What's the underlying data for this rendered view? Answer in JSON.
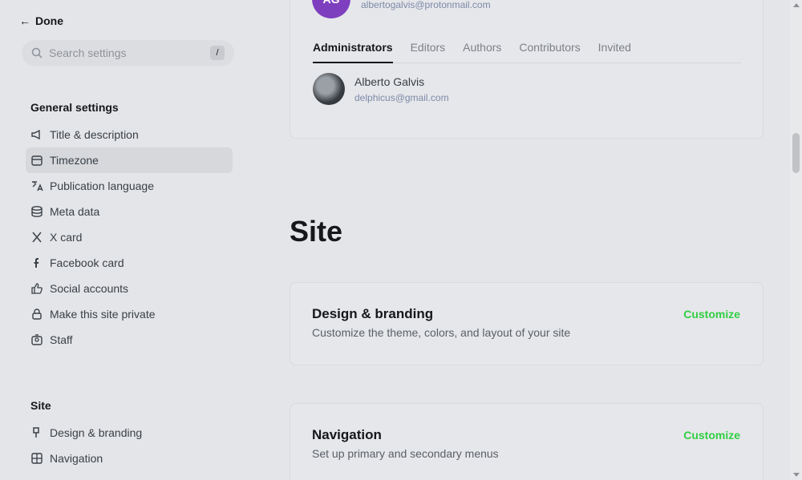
{
  "sidebar": {
    "done_label": "Done",
    "search_placeholder": "Search settings",
    "search_shortcut": "/",
    "general_title": "General settings",
    "general_items": [
      {
        "label": "Title & description",
        "icon": "megaphone-icon"
      },
      {
        "label": "Timezone",
        "icon": "calendar-icon"
      },
      {
        "label": "Publication language",
        "icon": "translate-icon"
      },
      {
        "label": "Meta data",
        "icon": "database-icon"
      },
      {
        "label": "X card",
        "icon": "x-logo-icon"
      },
      {
        "label": "Facebook card",
        "icon": "facebook-icon"
      },
      {
        "label": "Social accounts",
        "icon": "thumbs-up-icon"
      },
      {
        "label": "Make this site private",
        "icon": "lock-icon"
      },
      {
        "label": "Staff",
        "icon": "staff-icon"
      }
    ],
    "active_index": 1,
    "site_title": "Site",
    "site_items": [
      {
        "label": "Design & branding",
        "icon": "brush-icon"
      },
      {
        "label": "Navigation",
        "icon": "grid-icon"
      }
    ]
  },
  "main": {
    "top_card": {
      "avatar_initials": "AG",
      "email": "albertogalvis@protonmail.com",
      "tabs": [
        "Administrators",
        "Editors",
        "Authors",
        "Contributors",
        "Invited"
      ],
      "active_tab": 0,
      "user": {
        "name": "Alberto Galvis",
        "email": "delphicus@gmail.com"
      }
    },
    "site_heading": "Site",
    "cards": [
      {
        "title": "Design & branding",
        "desc": "Customize the theme, colors, and layout of your site",
        "action": "Customize"
      },
      {
        "title": "Navigation",
        "desc": "Set up primary and secondary menus",
        "action": "Customize"
      }
    ]
  },
  "colors": {
    "accent": "#30cf43",
    "avatar": "#7e3fbf",
    "background": "#e4e5e8"
  }
}
